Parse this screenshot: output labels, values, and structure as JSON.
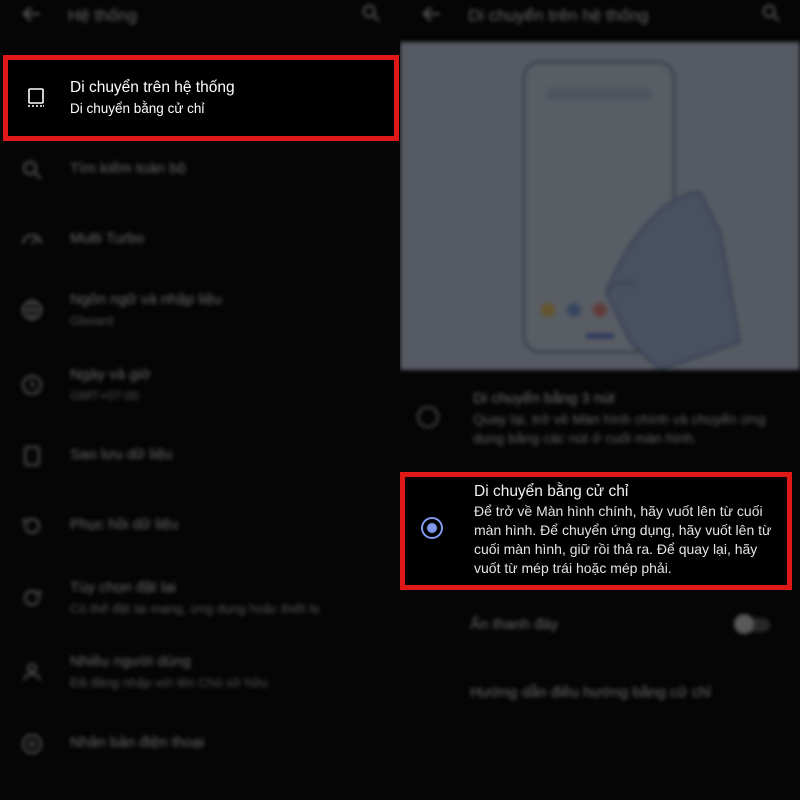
{
  "left": {
    "header": {
      "title": "Hệ thống"
    },
    "highlighted_item": {
      "title": "Di chuyển trên hệ thống",
      "subtitle": "Di chuyển bằng cử chỉ"
    },
    "items": [
      {
        "title": "Tìm kiếm toàn bộ",
        "subtitle": "",
        "icon": "search-icon"
      },
      {
        "title": "Multi Turbo",
        "subtitle": "",
        "icon": "turbo-icon"
      },
      {
        "title": "Ngôn ngữ và nhập liệu",
        "subtitle": "Gboard",
        "icon": "globe-icon"
      },
      {
        "title": "Ngày và giờ",
        "subtitle": "GMT+07:00",
        "icon": "clock-icon"
      },
      {
        "title": "Sao lưu dữ liệu",
        "subtitle": "",
        "icon": "backup-icon"
      },
      {
        "title": "Phục hồi dữ liệu",
        "subtitle": "",
        "icon": "restore-icon"
      },
      {
        "title": "Tùy chọn đặt lại",
        "subtitle": "Có thể đặt lại mạng, ứng dụng hoặc thiết bị",
        "icon": "reset-icon"
      },
      {
        "title": "Nhiều người dùng",
        "subtitle": "Đã đăng nhập với tên Chủ sở hữu",
        "icon": "user-icon"
      },
      {
        "title": "Nhân bản điện thoại",
        "subtitle": "",
        "icon": "clone-icon"
      }
    ]
  },
  "right": {
    "header": {
      "title": "Di chuyển trên hệ thống"
    },
    "options": [
      {
        "title": "Di chuyển bằng 3 nút",
        "description": "Quay lại, trở về Màn hình chính và chuyển ứng dụng bằng các nút ở cuối màn hình.",
        "selected": false
      },
      {
        "title": "Di chuyển bằng cử chỉ",
        "description": "Để trở về Màn hình chính, hãy vuốt lên từ cuối màn hình. Để chuyển ứng dụng, hãy vuốt lên từ cuối màn hình, giữ rồi thả ra. Để quay lại, hãy vuốt từ mép trái hoặc mép phải.",
        "selected": true
      }
    ],
    "hide_bar": {
      "label": "Ẩn thanh đáy",
      "enabled": false
    },
    "tutorial": {
      "label": "Hướng dẫn điều hướng bằng cử chỉ"
    }
  },
  "colors": {
    "highlight": "#e11818",
    "accent": "#7f99ec",
    "illustration_bg": "#c9d2e6"
  }
}
